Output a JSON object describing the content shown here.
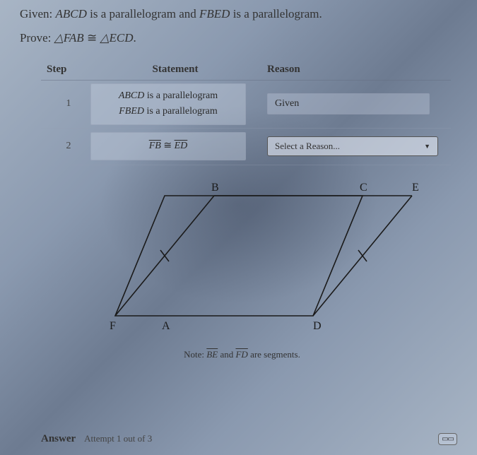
{
  "given": {
    "label": "Given:",
    "text_a": "ABCD",
    "mid1": " is a parallelogram and ",
    "text_b": "FBED",
    "mid2": " is a parallelogram."
  },
  "prove": {
    "label": "Prove:",
    "tri1": "△FAB",
    "cong": " ≅ ",
    "tri2": "△ECD",
    "end": "."
  },
  "table": {
    "headers": {
      "step": "Step",
      "stmt": "Statement",
      "rsn": "Reason"
    },
    "rows": [
      {
        "step": "1",
        "stmt_line1_a": "ABCD",
        "stmt_line1_b": " is a parallelogram",
        "stmt_line2_a": "FBED",
        "stmt_line2_b": " is a parallelogram",
        "reason": "Given"
      },
      {
        "step": "2",
        "seg1": "FB",
        "cong": " ≅ ",
        "seg2": "ED",
        "reason_placeholder": "Select a Reason..."
      }
    ]
  },
  "diagram": {
    "labels": {
      "B": "B",
      "C": "C",
      "E": "E",
      "F": "F",
      "A": "A",
      "D": "D"
    }
  },
  "note": {
    "pre": "Note: ",
    "seg1": "BE",
    "mid": " and ",
    "seg2": "FD",
    "post": " are segments."
  },
  "footer": {
    "answer": "Answer",
    "attempt": "Attempt 1 out of 3"
  }
}
